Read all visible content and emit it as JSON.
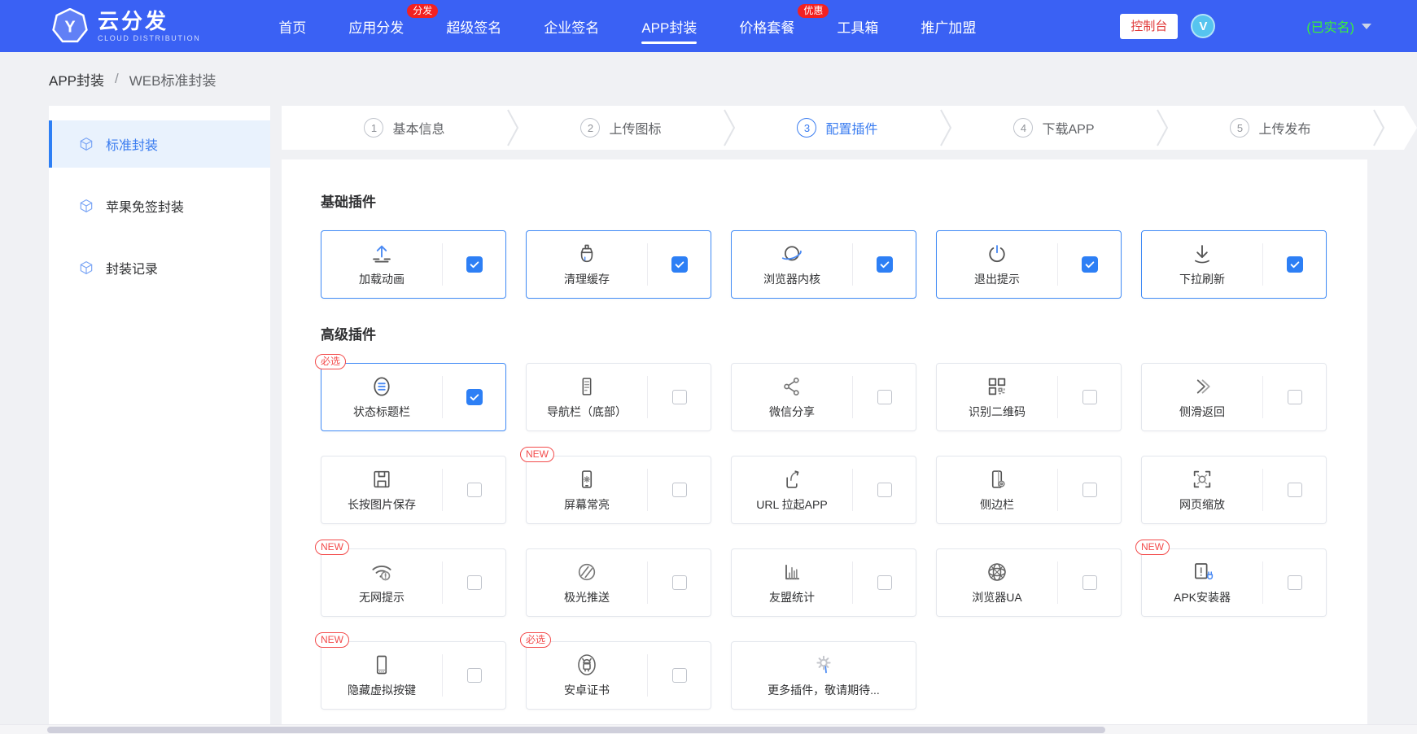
{
  "header": {
    "logo": {
      "letter": "Y",
      "title": "云分发",
      "subtitle": "CLOUD DISTRIBUTION"
    },
    "nav_items": [
      {
        "label": "首页"
      },
      {
        "label": "应用分发",
        "badge": "分发"
      },
      {
        "label": "超级签名"
      },
      {
        "label": "企业签名"
      },
      {
        "label": "APP封装",
        "active": true
      },
      {
        "label": "价格套餐",
        "badge": "优惠"
      },
      {
        "label": "工具箱"
      },
      {
        "label": "推广加盟"
      }
    ],
    "console_button": "控制台",
    "avatar_letter": "V",
    "account_status": "(已实名)"
  },
  "breadcrumb": {
    "section": "APP封装",
    "separator": "/",
    "page": "WEB标准封装"
  },
  "sidebar": {
    "items": [
      {
        "label": "标准封装",
        "icon": "cube-icon",
        "active": true
      },
      {
        "label": "苹果免签封装",
        "icon": "cube-icon"
      },
      {
        "label": "封装记录",
        "icon": "cube-icon"
      }
    ]
  },
  "steps": [
    {
      "num": "1",
      "label": "基本信息"
    },
    {
      "num": "2",
      "label": "上传图标"
    },
    {
      "num": "3",
      "label": "配置插件",
      "active": true
    },
    {
      "num": "4",
      "label": "下载APP"
    },
    {
      "num": "5",
      "label": "上传发布"
    }
  ],
  "plugin_sections": [
    {
      "title": "基础插件",
      "rows": [
        [
          {
            "label": "加载动画",
            "icon": "upload-animation-icon",
            "checked": true,
            "selected": true
          },
          {
            "label": "清理缓存",
            "icon": "clean-cache-icon",
            "checked": true,
            "selected": true
          },
          {
            "label": "浏览器内核",
            "icon": "browser-core-icon",
            "checked": true,
            "selected": true
          },
          {
            "label": "退出提示",
            "icon": "exit-prompt-icon",
            "checked": true,
            "selected": true
          },
          {
            "label": "下拉刷新",
            "icon": "pull-refresh-icon",
            "checked": true,
            "selected": true
          }
        ]
      ]
    },
    {
      "title": "高级插件",
      "rows": [
        [
          {
            "label": "状态标题栏",
            "icon": "status-titlebar-icon",
            "checked": true,
            "selected": true,
            "badge": "必选"
          },
          {
            "label": "导航栏（底部）",
            "icon": "bottom-nav-icon",
            "checked": false
          },
          {
            "label": "微信分享",
            "icon": "wechat-share-icon",
            "checked": false
          },
          {
            "label": "识别二维码",
            "icon": "qrcode-scan-icon",
            "checked": false
          },
          {
            "label": "侧滑返回",
            "icon": "swipe-back-icon",
            "checked": false
          }
        ],
        [
          {
            "label": "长按图片保存",
            "icon": "save-image-icon",
            "checked": false
          },
          {
            "label": "屏幕常亮",
            "icon": "screen-on-icon",
            "checked": false,
            "badge": "NEW"
          },
          {
            "label": "URL 拉起APP",
            "icon": "url-launch-icon",
            "checked": false
          },
          {
            "label": "侧边栏",
            "icon": "side-panel-icon",
            "checked": false
          },
          {
            "label": "网页缩放",
            "icon": "page-zoom-icon",
            "checked": false
          }
        ],
        [
          {
            "label": "无网提示",
            "icon": "no-network-icon",
            "checked": false,
            "badge": "NEW"
          },
          {
            "label": "极光推送",
            "icon": "jpush-icon",
            "checked": false
          },
          {
            "label": "友盟统计",
            "icon": "umeng-stats-icon",
            "checked": false
          },
          {
            "label": "浏览器UA",
            "icon": "browser-ua-icon",
            "checked": false
          },
          {
            "label": "APK安装器",
            "icon": "apk-installer-icon",
            "checked": false,
            "badge": "NEW"
          }
        ],
        [
          {
            "label": "隐藏虚拟按键",
            "icon": "hide-virtual-keys-icon",
            "checked": false,
            "badge": "NEW"
          },
          {
            "label": "安卓证书",
            "icon": "android-cert-icon",
            "checked": false,
            "badge": "必选"
          },
          {
            "label": "更多插件，敬请期待...",
            "icon": "gear-icon",
            "checkbox": false
          }
        ]
      ]
    }
  ],
  "colors": {
    "navbar_blue": "#3a61f4",
    "accent_blue": "#3a7cf0",
    "checked_blue": "#2d7ff5",
    "badge_red": "#f32121",
    "verified_green": "#39f139",
    "page_bg": "#f0f1f4"
  }
}
